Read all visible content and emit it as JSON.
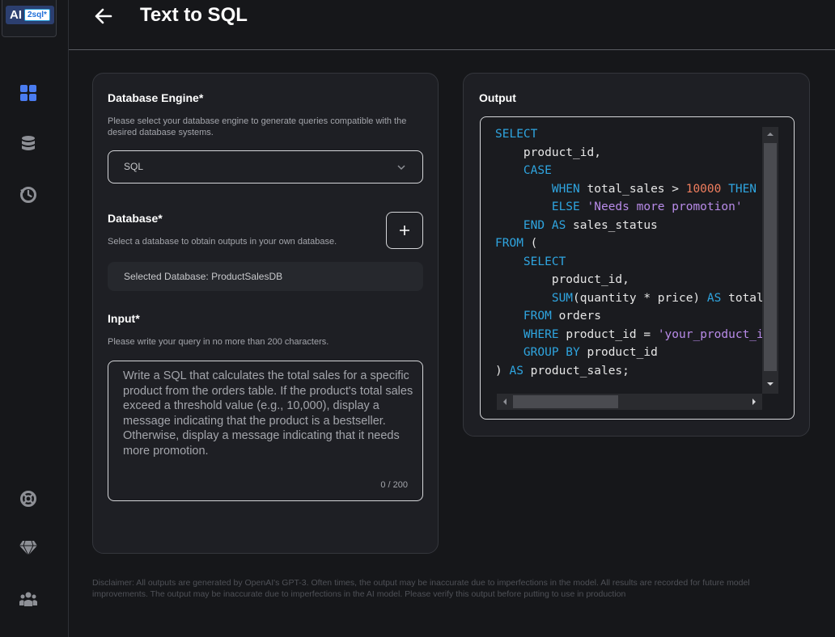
{
  "app": {
    "logo_ai": "AI",
    "logo_2sql": "2sql*",
    "title": "Text to SQL"
  },
  "sidebar": {
    "items": [
      {
        "icon": "dashboard-icon",
        "active": true
      },
      {
        "icon": "database-icon"
      },
      {
        "icon": "history-icon"
      },
      {
        "icon": "support-icon"
      },
      {
        "icon": "diamond-icon"
      },
      {
        "icon": "team-icon"
      }
    ]
  },
  "engine": {
    "label": "Database Engine*",
    "help": "Please select your database engine to generate queries compatible with the desired database systems.",
    "value": "SQL"
  },
  "database": {
    "label": "Database*",
    "help": "Select a database to obtain outputs in your own database.",
    "selected": "Selected Database: ProductSalesDB",
    "add": "+"
  },
  "input": {
    "label": "Input*",
    "help": "Please write your query in no more than 200 characters.",
    "placeholder": "Write a SQL that calculates the total sales for a specific product from the orders table. If the product's total sales exceed a threshold value (e.g., 10,000), display a message indicating that the product is a bestseller. Otherwise, display a message indicating that it needs more promotion.",
    "counter": "0 / 200"
  },
  "output": {
    "label": "Output",
    "code_lines": [
      [
        [
          "kw",
          "SELECT"
        ]
      ],
      [
        [
          "t",
          "    product_id,"
        ]
      ],
      [
        [
          "kw",
          "    CASE"
        ]
      ],
      [
        [
          "kw",
          "        WHEN "
        ],
        [
          "t",
          "total_sales > "
        ],
        [
          "num",
          "10000"
        ],
        [
          "kw",
          " THEN 'Bestseller'"
        ]
      ],
      [
        [
          "kw",
          "        ELSE "
        ],
        [
          "str",
          "'Needs more promotion'"
        ]
      ],
      [
        [
          "kw",
          "    END AS "
        ],
        [
          "t",
          "sales_status"
        ]
      ],
      [
        [
          "kw",
          "FROM "
        ],
        [
          "t",
          "("
        ]
      ],
      [
        [
          "kw",
          "    SELECT"
        ]
      ],
      [
        [
          "t",
          "        product_id,"
        ]
      ],
      [
        [
          "kw",
          "        SUM"
        ],
        [
          "t",
          "(quantity * price) "
        ],
        [
          "kw",
          "AS "
        ],
        [
          "t",
          "total_sales"
        ]
      ],
      [
        [
          "kw",
          "    FROM "
        ],
        [
          "t",
          "orders"
        ]
      ],
      [
        [
          "kw",
          "    WHERE "
        ],
        [
          "t",
          "product_id = "
        ],
        [
          "str",
          "'your_product_id'"
        ]
      ],
      [
        [
          "kw",
          "    GROUP BY "
        ],
        [
          "t",
          "product_id"
        ]
      ],
      [
        [
          "t",
          ") "
        ],
        [
          "kw",
          "AS "
        ],
        [
          "t",
          "product_sales;"
        ]
      ]
    ]
  },
  "disclaimer": "Disclaimer: All outputs are generated by OpenAI's GPT-3. Often times, the output may be inaccurate due to imperfections in the model. All results are recorded for future model improvements. The output may be inaccurate due to imperfections in the AI model. Please verify this output before putting to use in production",
  "colors": {
    "background": "#16171a",
    "card": "#1e1f24",
    "accent": "#4a7cf0",
    "keyword": "#2fa5e0",
    "number": "#f07e5e",
    "string": "#b88be8"
  }
}
